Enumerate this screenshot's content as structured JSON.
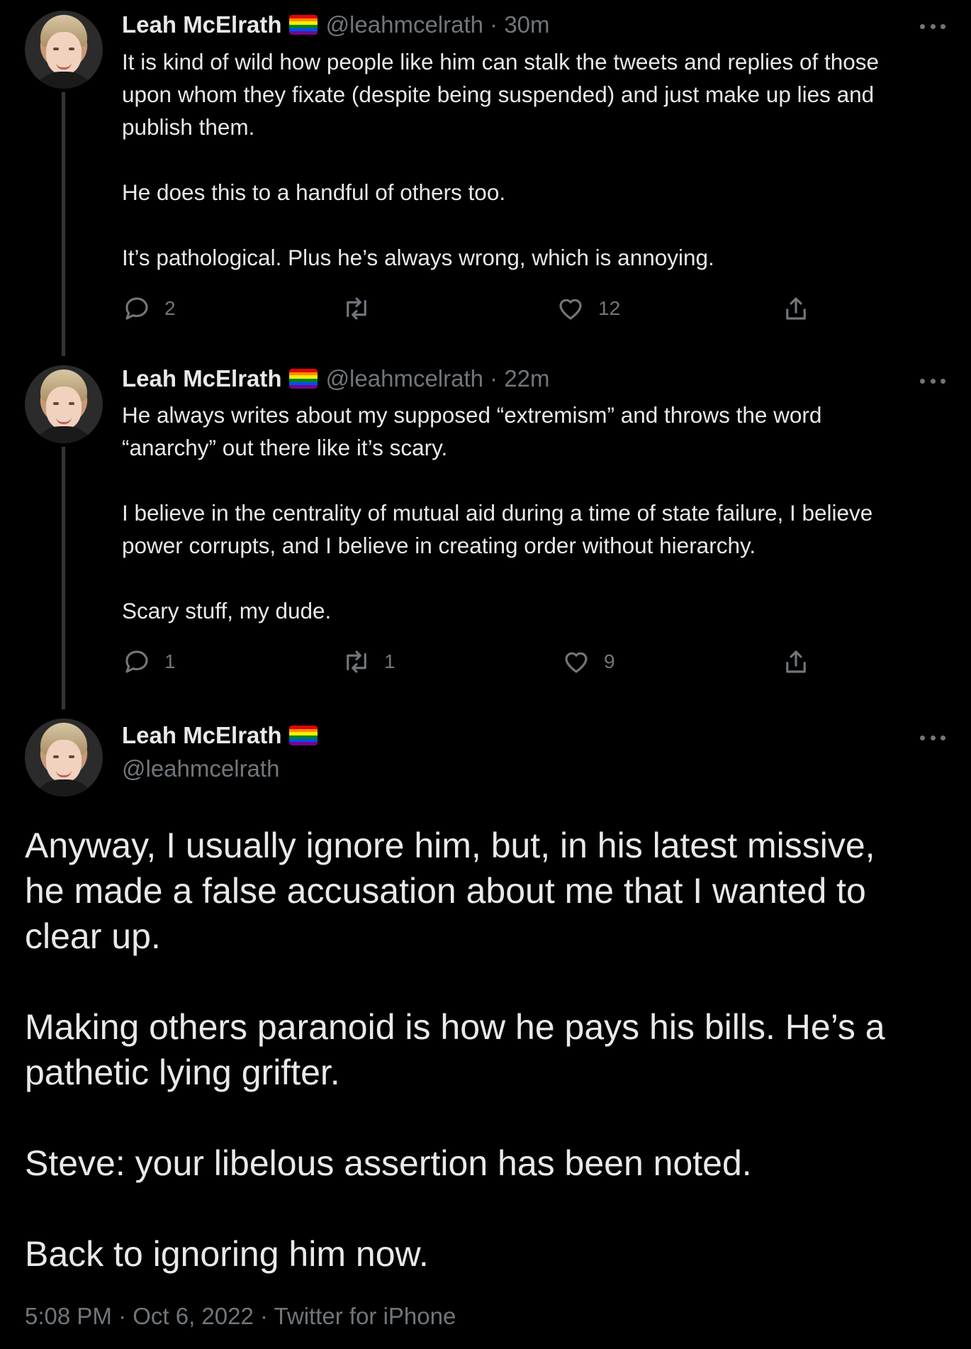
{
  "colors": {
    "background": "#000000",
    "text": "#e7e9ea",
    "muted": "#71767b",
    "thread_line": "#333639"
  },
  "flag_colors": [
    "#e40303",
    "#ff8c00",
    "#ffed00",
    "#008026",
    "#004dff",
    "#750787"
  ],
  "tweets": [
    {
      "name": "Leah McElrath",
      "handle": "@leahmcelrath",
      "time": "· 30m",
      "lines": [
        "It is kind of wild how people like him can stalk the tweets and replies of those",
        "upon whom they fixate (despite being suspended) and just make up lies and",
        "publish them.",
        "",
        "He does this to a handful of others too.",
        "",
        "It’s pathological. Plus he’s always wrong, which is annoying."
      ],
      "replies": "2",
      "retweets": "",
      "likes": "12"
    },
    {
      "name": "Leah McElrath",
      "handle": "@leahmcelrath",
      "time": "· 22m",
      "lines": [
        "He always writes about my supposed “extremism” and throws the word",
        "“anarchy” out there like it’s scary.",
        "",
        "I believe in the centrality of mutual aid during a time of state failure, I believe",
        "power corrupts, and I believe in creating order without hierarchy.",
        "",
        "Scary stuff, my dude."
      ],
      "replies": "1",
      "retweets": "1",
      "likes": "9"
    }
  ],
  "main_tweet": {
    "name": "Leah McElrath",
    "handle": "@leahmcelrath",
    "lines": [
      "Anyway, I usually ignore him, but, in his latest missive,",
      "he made a false accusation about me that I wanted to",
      "clear up.",
      "",
      "Making others paranoid is how he pays his bills. He’s a",
      "pathetic lying grifter.",
      "",
      "Steve: your libelous assertion has been noted.",
      "",
      "Back to ignoring him now."
    ],
    "meta": "5:08 PM · Oct 6, 2022 · Twitter for iPhone"
  },
  "icons": [
    "avatar",
    "rainbow-flag-icon",
    "more-icon",
    "reply-icon",
    "retweet-icon",
    "like-icon",
    "share-icon"
  ]
}
